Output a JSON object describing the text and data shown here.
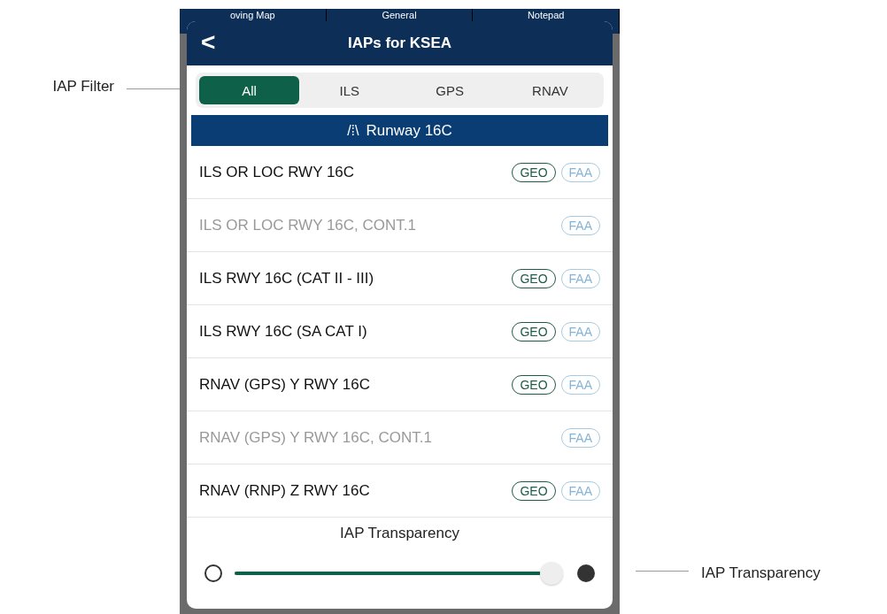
{
  "filter_callout": "IAP Filter",
  "transparency_callout": "IAP Transparency",
  "background_tabs": [
    "oving Map",
    "General",
    "Notepad"
  ],
  "dialog": {
    "title": "IAPs for KSEA",
    "back": "<",
    "filters": [
      {
        "label": "All",
        "selected": true
      },
      {
        "label": "ILS",
        "selected": false
      },
      {
        "label": "GPS",
        "selected": false
      },
      {
        "label": "RNAV",
        "selected": false
      }
    ],
    "runway": {
      "icon": "/⁞\\",
      "label": "Runway 16C"
    },
    "procedures": [
      {
        "name": "ILS OR LOC RWY 16C",
        "dimmed": false,
        "badges": [
          {
            "label": "GEO",
            "kind": "geo"
          },
          {
            "label": "FAA",
            "kind": "faa"
          }
        ]
      },
      {
        "name": "ILS OR LOC RWY 16C, CONT.1",
        "dimmed": true,
        "badges": [
          {
            "label": "FAA",
            "kind": "faa"
          }
        ]
      },
      {
        "name": "ILS RWY 16C (CAT II - III)",
        "dimmed": false,
        "badges": [
          {
            "label": "GEO",
            "kind": "geo"
          },
          {
            "label": "FAA",
            "kind": "faa"
          }
        ]
      },
      {
        "name": "ILS RWY 16C (SA CAT I)",
        "dimmed": false,
        "badges": [
          {
            "label": "GEO",
            "kind": "geo"
          },
          {
            "label": "FAA",
            "kind": "faa"
          }
        ]
      },
      {
        "name": "RNAV (GPS) Y RWY 16C",
        "dimmed": false,
        "badges": [
          {
            "label": "GEO",
            "kind": "geo"
          },
          {
            "label": "FAA",
            "kind": "faa"
          }
        ]
      },
      {
        "name": "RNAV (GPS) Y RWY 16C, CONT.1",
        "dimmed": true,
        "badges": [
          {
            "label": "FAA",
            "kind": "faa"
          }
        ]
      },
      {
        "name": "RNAV (RNP) Z RWY 16C",
        "dimmed": false,
        "badges": [
          {
            "label": "GEO",
            "kind": "geo"
          },
          {
            "label": "FAA",
            "kind": "faa"
          }
        ]
      }
    ],
    "transparency": {
      "label": "IAP Transparency",
      "level": 0.96
    }
  }
}
